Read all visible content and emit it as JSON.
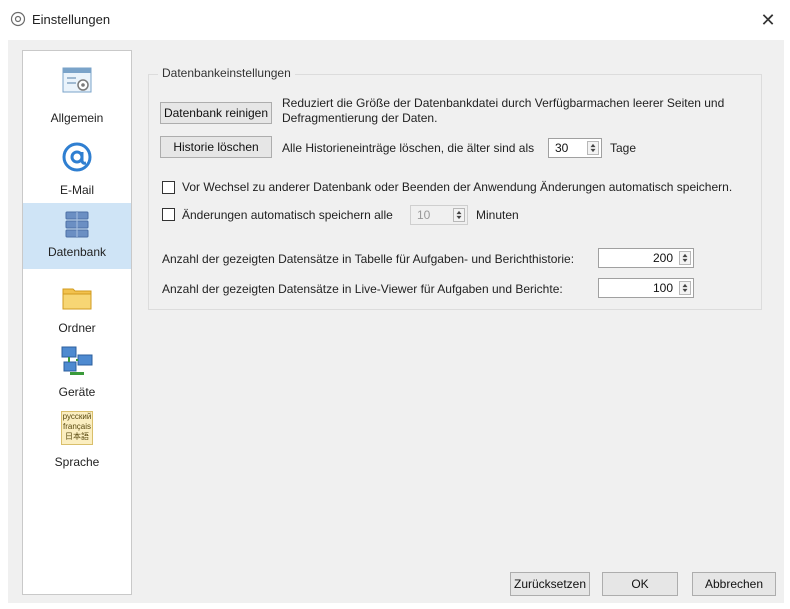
{
  "window": {
    "title": "Einstellungen",
    "title_icon": "gear-icon",
    "close_label": "✕"
  },
  "sidebar": {
    "items": [
      {
        "label": "Allgemein",
        "icon": "settings-window-icon",
        "active": false
      },
      {
        "label": "E-Mail",
        "icon": "at-sign-icon",
        "active": false
      },
      {
        "label": "Datenbank",
        "icon": "database-icon",
        "active": true
      },
      {
        "label": "Ordner",
        "icon": "folder-icon",
        "active": false
      },
      {
        "label": "Geräte",
        "icon": "network-computers-icon",
        "active": false
      },
      {
        "label": "Sprache",
        "icon": "language-icon",
        "active": false
      }
    ],
    "language_icon_lines": [
      "русский",
      "français",
      "日本語"
    ]
  },
  "group": {
    "title": "Datenbankeinstellungen",
    "clean_button": "Datenbank reinigen",
    "clean_description": "Reduziert die Größe der Datenbankdatei durch Verfügbarmachen leerer Seiten und",
    "clean_description_2": "Defragmentierung der Daten.",
    "history_button": "Historie löschen",
    "history_text": "Alle Historieneinträge löschen, die älter sind als",
    "history_days": "30",
    "history_unit": "Tage",
    "autosave_on_switch_label": "Vor Wechsel zu anderer Datenbank oder Beenden der Anwendung Änderungen automatisch speichern.",
    "autosave_on_switch_checked": false,
    "autosave_interval_label": "Änderungen automatisch speichern alle",
    "autosave_interval_checked": false,
    "autosave_interval_value": "10",
    "autosave_interval_unit": "Minuten",
    "history_rows_label": "Anzahl der gezeigten Datensätze in Tabelle für Aufgaben- und Berichthistorie:",
    "history_rows_value": "200",
    "liveviewer_rows_label": "Anzahl der gezeigten Datensätze in Live-Viewer für Aufgaben und Berichte:",
    "liveviewer_rows_value": "100"
  },
  "footer": {
    "reset_label": "Zurücksetzen",
    "ok_label": "OK",
    "cancel_label": "Abbrechen"
  }
}
